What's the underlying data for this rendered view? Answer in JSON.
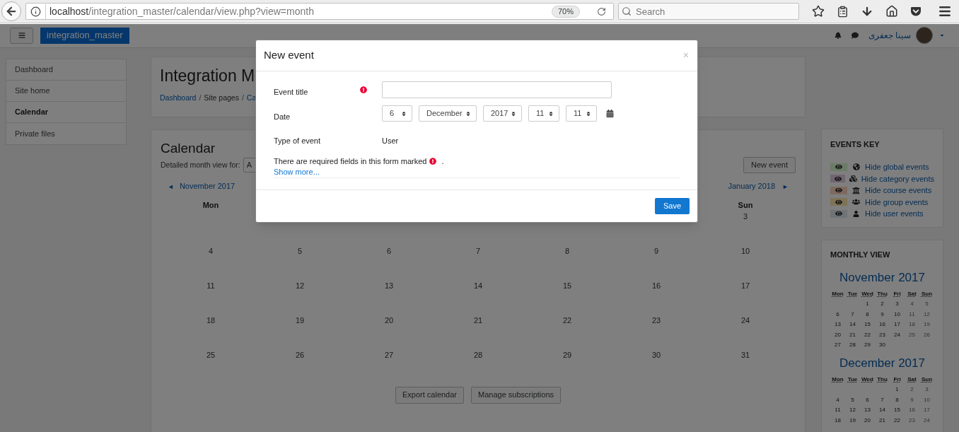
{
  "browser": {
    "url_host": "localhost",
    "url_path": "/integration_master/calendar/view.php?view=month",
    "zoom": "70%",
    "search_placeholder": "Search"
  },
  "navbar": {
    "site_button": "integration_master",
    "user_name": "سينا جعفری"
  },
  "sidebar": {
    "items": [
      {
        "label": "Dashboard",
        "selected": false
      },
      {
        "label": "Site home",
        "selected": false
      },
      {
        "label": "Calendar",
        "selected": true
      },
      {
        "label": "Private files",
        "selected": false
      }
    ]
  },
  "header": {
    "title": "Integration M",
    "breadcrumb": [
      {
        "label": "Dashboard",
        "kind": "link"
      },
      {
        "label": "Site pages",
        "kind": "text"
      },
      {
        "label": "Ca",
        "kind": "link"
      }
    ],
    "separator": "/"
  },
  "calendar": {
    "title": "Calendar",
    "filter_label": "Detailed month view for:",
    "filter_value": "A",
    "new_event_button": "New event",
    "prev_arrow": "◄",
    "prev_month": "November 2017",
    "next_month": "January 2018",
    "next_arrow": "►",
    "weekdays": [
      {
        "kind": "label",
        "label": "Mon"
      },
      {
        "kind": "blank"
      },
      {
        "kind": "blank"
      },
      {
        "kind": "blank"
      },
      {
        "kind": "blank"
      },
      {
        "kind": "blank"
      },
      {
        "kind": "label",
        "label": "Sun"
      }
    ],
    "weeks": [
      [
        {
          "kind": "blank"
        },
        {
          "kind": "blank"
        },
        {
          "kind": "blank"
        },
        {
          "kind": "blank"
        },
        {
          "kind": "blank"
        },
        {
          "kind": "blank"
        },
        {
          "kind": "day",
          "label": "3"
        }
      ],
      [
        {
          "kind": "day",
          "label": "4"
        },
        {
          "kind": "day",
          "label": "5"
        },
        {
          "kind": "day",
          "label": "6"
        },
        {
          "kind": "day",
          "label": "7"
        },
        {
          "kind": "day",
          "label": "8"
        },
        {
          "kind": "day",
          "label": "9"
        },
        {
          "kind": "day",
          "label": "10"
        }
      ],
      [
        {
          "kind": "day",
          "label": "11"
        },
        {
          "kind": "day",
          "label": "12"
        },
        {
          "kind": "day",
          "label": "13"
        },
        {
          "kind": "day",
          "label": "14"
        },
        {
          "kind": "day",
          "label": "15"
        },
        {
          "kind": "day",
          "label": "16"
        },
        {
          "kind": "day",
          "label": "17"
        }
      ],
      [
        {
          "kind": "day",
          "label": "18"
        },
        {
          "kind": "day",
          "label": "19"
        },
        {
          "kind": "day",
          "label": "20"
        },
        {
          "kind": "day",
          "label": "21"
        },
        {
          "kind": "day",
          "label": "22"
        },
        {
          "kind": "day",
          "label": "23"
        },
        {
          "kind": "day",
          "label": "24"
        }
      ],
      [
        {
          "kind": "day",
          "label": "25"
        },
        {
          "kind": "day",
          "label": "26"
        },
        {
          "kind": "day",
          "label": "27"
        },
        {
          "kind": "day",
          "label": "28"
        },
        {
          "kind": "day",
          "label": "29"
        },
        {
          "kind": "day",
          "label": "30"
        },
        {
          "kind": "day",
          "label": "31"
        }
      ]
    ],
    "buttons": [
      "Export calendar",
      "Manage subscriptions"
    ]
  },
  "events_key": {
    "title": "EVENTS KEY",
    "items": [
      {
        "kind": "global",
        "label": "Hide global events",
        "color": "#6b7c66"
      },
      {
        "kind": "category",
        "label": "Hide category events",
        "color": "#706570"
      },
      {
        "kind": "course",
        "label": "Hide course events",
        "color": "#7f695e"
      },
      {
        "kind": "group",
        "label": "Hide group events",
        "color": "#7f7357"
      },
      {
        "kind": "user",
        "label": "Hide user events",
        "color": "#6e7376"
      }
    ]
  },
  "monthly_view": {
    "title": "MONTHLY VIEW",
    "months": [
      {
        "title": "November 2017",
        "weekdays": [
          "Mon",
          "Tue",
          "Wed",
          "Thu",
          "Fri",
          "Sat",
          "Sun"
        ],
        "weeks": [
          [
            {
              "kind": "blank"
            },
            {
              "kind": "blank"
            },
            {
              "kind": "day",
              "label": "1"
            },
            {
              "kind": "day",
              "label": "2"
            },
            {
              "kind": "day",
              "label": "3"
            },
            {
              "kind": "day",
              "label": "4"
            },
            {
              "kind": "day",
              "label": "5"
            }
          ],
          [
            {
              "kind": "day",
              "label": "6"
            },
            {
              "kind": "day",
              "label": "7"
            },
            {
              "kind": "day",
              "label": "8"
            },
            {
              "kind": "day",
              "label": "9"
            },
            {
              "kind": "day",
              "label": "10"
            },
            {
              "kind": "day",
              "label": "11"
            },
            {
              "kind": "day",
              "label": "12"
            }
          ],
          [
            {
              "kind": "day",
              "label": "13"
            },
            {
              "kind": "day",
              "label": "14"
            },
            {
              "kind": "day",
              "label": "15"
            },
            {
              "kind": "day",
              "label": "16"
            },
            {
              "kind": "day",
              "label": "17"
            },
            {
              "kind": "day",
              "label": "18"
            },
            {
              "kind": "day",
              "label": "19"
            }
          ],
          [
            {
              "kind": "day",
              "label": "20"
            },
            {
              "kind": "day",
              "label": "21"
            },
            {
              "kind": "day",
              "label": "22"
            },
            {
              "kind": "day",
              "label": "23"
            },
            {
              "kind": "day",
              "label": "24"
            },
            {
              "kind": "day",
              "label": "25"
            },
            {
              "kind": "day",
              "label": "26"
            }
          ],
          [
            {
              "kind": "day",
              "label": "27"
            },
            {
              "kind": "day",
              "label": "28"
            },
            {
              "kind": "day",
              "label": "29"
            },
            {
              "kind": "day",
              "label": "30"
            },
            {
              "kind": "blank"
            },
            {
              "kind": "blank"
            },
            {
              "kind": "blank"
            }
          ]
        ]
      },
      {
        "title": "December 2017",
        "weekdays": [
          "Mon",
          "Tue",
          "Wed",
          "Thu",
          "Fri",
          "Sat",
          "Sun"
        ],
        "weeks": [
          [
            {
              "kind": "blank"
            },
            {
              "kind": "blank"
            },
            {
              "kind": "blank"
            },
            {
              "kind": "blank"
            },
            {
              "kind": "day",
              "label": "1"
            },
            {
              "kind": "day",
              "label": "2"
            },
            {
              "kind": "day",
              "label": "3"
            }
          ],
          [
            {
              "kind": "day",
              "label": "4"
            },
            {
              "kind": "day",
              "label": "5"
            },
            {
              "kind": "day",
              "label": "6"
            },
            {
              "kind": "day",
              "label": "7"
            },
            {
              "kind": "day",
              "label": "8"
            },
            {
              "kind": "day",
              "label": "9"
            },
            {
              "kind": "day",
              "label": "10"
            }
          ],
          [
            {
              "kind": "day",
              "label": "11"
            },
            {
              "kind": "day",
              "label": "12"
            },
            {
              "kind": "day",
              "label": "13"
            },
            {
              "kind": "day",
              "label": "14"
            },
            {
              "kind": "day",
              "label": "15"
            },
            {
              "kind": "day",
              "label": "16"
            },
            {
              "kind": "day",
              "label": "17"
            }
          ],
          [
            {
              "kind": "day",
              "label": "18"
            },
            {
              "kind": "day",
              "label": "19"
            },
            {
              "kind": "day",
              "label": "20"
            },
            {
              "kind": "day",
              "label": "21"
            },
            {
              "kind": "day",
              "label": "22"
            },
            {
              "kind": "day",
              "label": "23"
            },
            {
              "kind": "day",
              "label": "24"
            }
          ]
        ]
      }
    ]
  },
  "modal": {
    "title": "New event",
    "close": "×",
    "fields": [
      {
        "kind": "text",
        "label": "Event title",
        "required": true
      },
      {
        "kind": "date",
        "label": "Date",
        "required": false,
        "selects": [
          "6",
          "December",
          "2017",
          "11",
          "11"
        ]
      },
      {
        "kind": "static",
        "label": "Type of event",
        "required": false,
        "value": "User"
      }
    ],
    "note_before": "There are required fields in this form marked",
    "note_after": ".",
    "show_more": "Show more...",
    "save_button": "Save"
  }
}
